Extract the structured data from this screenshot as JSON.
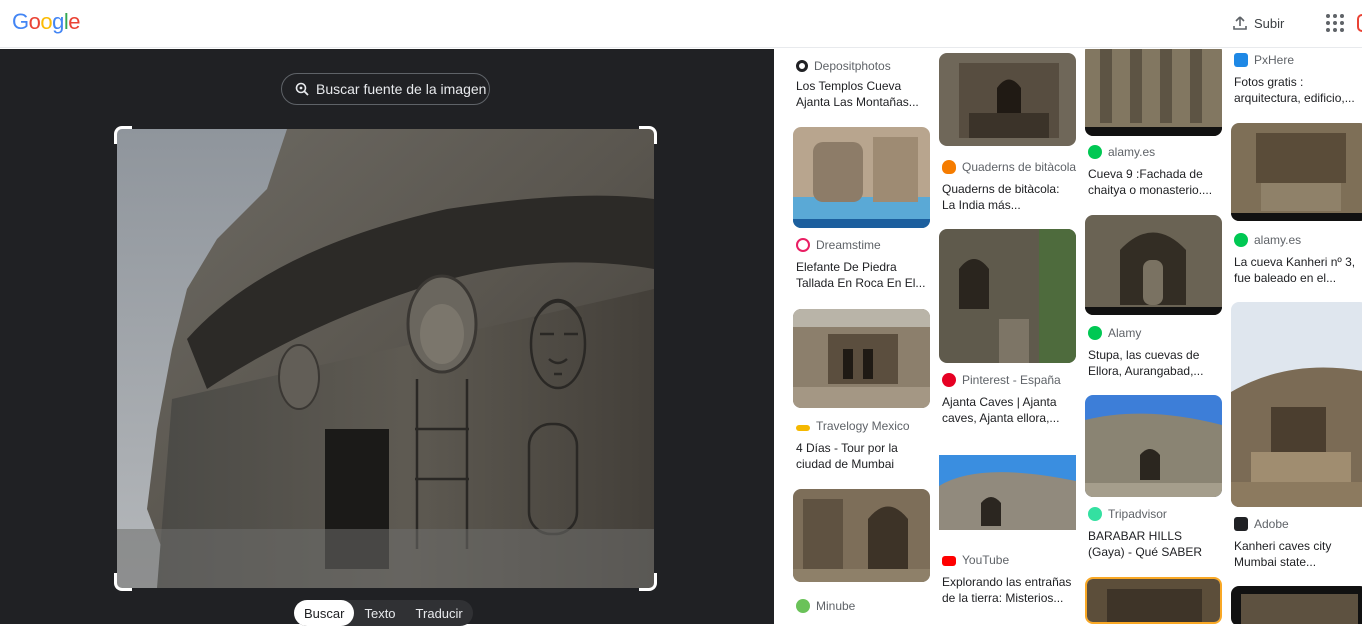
{
  "header": {
    "logo": [
      "G",
      "o",
      "o",
      "g",
      "l",
      "e"
    ],
    "upload_label": "Subir"
  },
  "lens": {
    "source_button": "Buscar fuente de la imagen",
    "tabs": [
      "Buscar",
      "Texto",
      "Traducir"
    ],
    "active_tab": "Buscar"
  },
  "results": {
    "col1": [
      {
        "source": "Depositphotos",
        "title": "Los Templos Cueva Ajanta Las Montañas..."
      },
      {
        "source": "Dreamstime",
        "title": "Elefante De Piedra Tallada En Roca En El..."
      },
      {
        "source": "Travelogy Mexico",
        "title": "4 Días - Tour por la ciudad de Mumbai"
      },
      {
        "source": "Minube",
        "title": ""
      }
    ],
    "col2": [
      {
        "source": "Quaderns de bitàcola",
        "title": "Quaderns de bitàcola: La India más..."
      },
      {
        "source": "Pinterest - España",
        "title": "Ajanta Caves | Ajanta caves, Ajanta ellora,..."
      },
      {
        "source": "YouTube",
        "title": "Explorando las entrañas de la tierra: Misterios..."
      }
    ],
    "col3": [
      {
        "source": "alamy.es",
        "title": "Cueva 9 :Fachada de chaitya o monasterio...."
      },
      {
        "source": "Alamy",
        "title": "Stupa, las cuevas de Ellora, Aurangabad,..."
      },
      {
        "source": "Tripadvisor",
        "title": "BARABAR HILLS (Gaya) - Qué SABER antes de ..."
      }
    ],
    "col4": [
      {
        "source": "PxHere",
        "title": "Fotos gratis : arquitectura, edificio,..."
      },
      {
        "source": "alamy.es",
        "title": "La cueva Kanheri nº 3, fue baleado en el..."
      },
      {
        "source": "Adobe",
        "title": "Kanheri caves city Mumbai state..."
      }
    ]
  },
  "colors": {
    "dark_bg": "#202124",
    "google_blue": "#4285f4",
    "google_red": "#ea4335",
    "google_yellow": "#fbbc05",
    "google_green": "#34a853"
  },
  "icons": [
    "upload-icon",
    "apps-icon",
    "lens-search-icon"
  ]
}
